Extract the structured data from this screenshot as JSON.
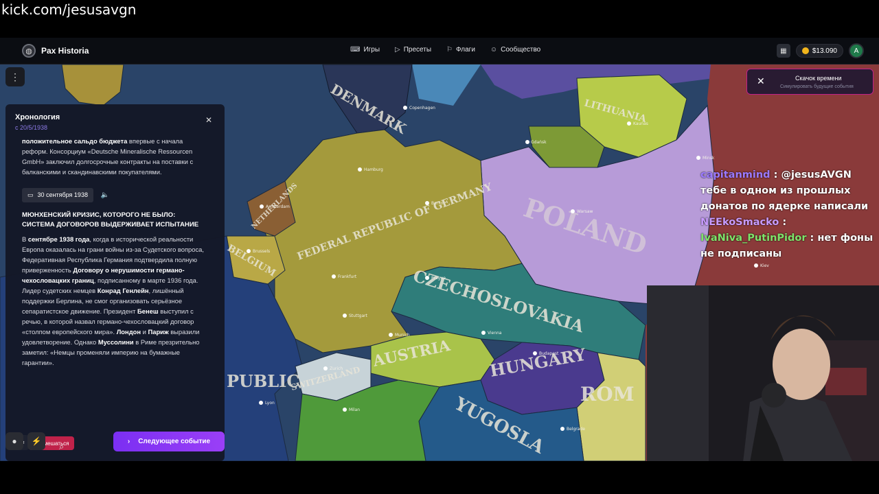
{
  "stream": {
    "url": "kick.com/jesusavgn"
  },
  "app": {
    "name": "Pax Historia",
    "nav": [
      {
        "label": "Игры",
        "icon": "gamepad-icon"
      },
      {
        "label": "Пресеты",
        "icon": "play-icon"
      },
      {
        "label": "Флаги",
        "icon": "flag-icon"
      },
      {
        "label": "Сообщество",
        "icon": "users-icon"
      }
    ],
    "balance": "$13.090",
    "avatar_letter": "A"
  },
  "time_skip": {
    "title": "Скачок времени",
    "subtitle": "Симулировать будущие события"
  },
  "timeline": {
    "title": "Хронология",
    "date": "с 20/5/1938",
    "prev_text_bold": "положительное сальдо бюджета",
    "prev_text": " впервые с начала реформ. Консорциум «Deutsche Mineralische Ressourcen GmbH» заключил долгосрочные контракты на поставки с балканскими и скандинавскими покупателями.",
    "event_date": "30 сентября 1938",
    "event_title": "МЮНХЕНСКИЙ КРИЗИС, КОТОРОГО НЕ БЫЛО: СИСТЕМА ДОГОВОРОВ ВЫДЕРЖИВАЕТ ИСПЫТАНИЕ",
    "p": [
      "В ",
      "сентябре 1938 года",
      ", когда в исторической реальности Европа оказалась на грани войны из-за Судетского вопроса, Федеративная Республика Германия подтвердила полную приверженность ",
      "Договору о нерушимости германо-чехословацких границ",
      ", подписанному в марте 1936 года. Лидер судетских немцев ",
      "Конрад Генлейн",
      ", лишённый поддержки Берлина, не смог организовать серьёзное сепаратистское движение. Президент ",
      "Бенеш",
      " выступил с речью, в которой назвал германо-чехословацкий договор «столпом европейского мира». ",
      "Лондон",
      " и ",
      "Париж",
      " выразили удовлетворение. Однако ",
      "Муссолини",
      " в Риме презрительно заметил: «Немцы променяли империю на бумажные гарантии»."
    ],
    "interfere_label": "Вмешаться",
    "next_label": "Следующее событие"
  },
  "map": {
    "countries": [
      "DENMARK",
      "LITHUANIA",
      "FEDERAL REPUBLIC OF GERMANY",
      "POLAND",
      "NETHERLANDS",
      "BELGIUM",
      "CZECHOSLOVAKIA",
      "AUSTRIA",
      "HUNGARY",
      "SWITZERLAND",
      "YUGOSLA",
      "ROM",
      "PUBLIC"
    ],
    "cities": [
      "Copenhagen",
      "Gdańsk",
      "Kaunas",
      "Hamburg",
      "Berlin",
      "Warsaw",
      "Amsterdam",
      "Brussels",
      "Frankfurt",
      "Prague",
      "Vienna",
      "Budapest",
      "Munich",
      "Stuttgart",
      "Zurich",
      "Milan",
      "Lyon",
      "Belgrade",
      "Minsk",
      "Kiev"
    ]
  },
  "chat": [
    {
      "user": "capitanmind",
      "msg": " : @jesusAVGN тебе в одном из прошлых донатов по ядерке написали"
    },
    {
      "user": "NEEkoSmacko",
      "msg": " :"
    },
    {
      "user": "IvaNiva_PutinPidor",
      "msg": " : нет фоны не подписаны"
    }
  ]
}
